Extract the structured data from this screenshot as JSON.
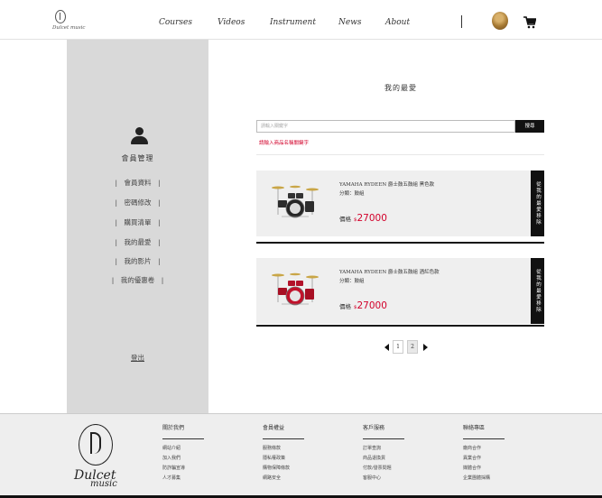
{
  "nav": {
    "logo_text": "Dulcet music",
    "links": [
      {
        "label": "Courses"
      },
      {
        "label": "Videos"
      },
      {
        "label": "Instrument"
      },
      {
        "label": "News"
      },
      {
        "label": "About"
      }
    ],
    "cart_icon": "cart-icon",
    "avatar_icon": "avatar"
  },
  "sidebar": {
    "title": "會員管理",
    "items": [
      {
        "label": "|　會員資料　|"
      },
      {
        "label": "|　密碼修改　|"
      },
      {
        "label": "|　購買清單　|"
      },
      {
        "label": "|　我的最愛　|"
      },
      {
        "label": "|　我的影片　|"
      },
      {
        "label": "|　我的優惠卷　|"
      }
    ],
    "logout": "登出"
  },
  "main": {
    "heading": "我的最愛",
    "search": {
      "placeholder": "請輸入關鍵字",
      "button": "搜尋",
      "hint": "請輸入商品名稱關鍵字"
    },
    "products": [
      {
        "name": "YAMAHA RYDEEN 爵士鼓五鼓組 黑色款",
        "category": "分類：鼓組",
        "price_label": "價格",
        "currency": "$",
        "price": "27000",
        "remove_label": "從我的最愛移除"
      },
      {
        "name": "YAMAHA RYDEEN 爵士鼓五鼓組 酒紅色款",
        "category": "分類：鼓組",
        "price_label": "價格",
        "currency": "$",
        "price": "27000",
        "remove_label": "從我的最愛移除"
      }
    ],
    "pagination": {
      "pages": [
        "1",
        "2"
      ],
      "current": "2"
    }
  },
  "footer": {
    "logo_word1": "Dulcet",
    "logo_word2": "music",
    "columns": [
      {
        "title": "關於我們",
        "links": [
          "網站介紹",
          "加入我們",
          "防詐騙宣導",
          "人才募集"
        ]
      },
      {
        "title": "會員權益",
        "links": [
          "服務條款",
          "隱私權政策",
          "購物保障條款",
          "網路安全"
        ]
      },
      {
        "title": "客戶服務",
        "links": [
          "訂單查詢",
          "商品退換貨",
          "付款/發票問題",
          "客服中心"
        ]
      },
      {
        "title": "聯絡專區",
        "links": [
          "廠商合作",
          "異業合作",
          "媒體合作",
          "企業團體採購"
        ]
      }
    ]
  },
  "colors": {
    "accent_red": "#d2002a",
    "sidebar_bg": "#d9d9d9",
    "dark": "#111111"
  }
}
